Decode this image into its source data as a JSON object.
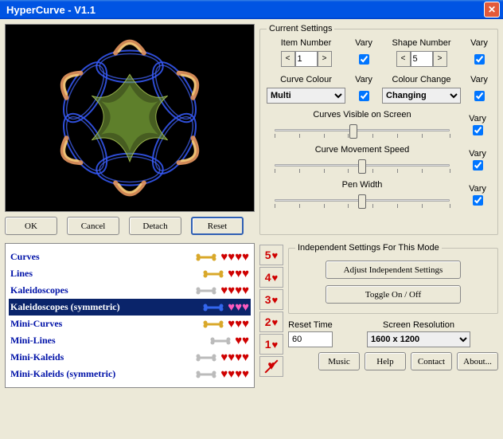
{
  "window": {
    "title": "HyperCurve - V1.1",
    "close_icon": "✕"
  },
  "buttons": {
    "ok": "OK",
    "cancel": "Cancel",
    "detach": "Detach",
    "reset": "Reset"
  },
  "settings": {
    "legend": "Current Settings",
    "item_number_label": "Item Number",
    "item_number_value": "1",
    "vary_label": "Vary",
    "shape_number_label": "Shape Number",
    "shape_number_value": "5",
    "curve_colour_label": "Curve Colour",
    "curve_colour_value": "Multi",
    "colour_change_label": "Colour Change",
    "colour_change_value": "Changing",
    "curves_visible_label": "Curves Visible on Screen",
    "movement_speed_label": "Curve Movement Speed",
    "pen_width_label": "Pen Width"
  },
  "modes": [
    {
      "name": "Curves",
      "bone": "gold",
      "hearts": 4,
      "selected": false
    },
    {
      "name": "Lines",
      "bone": "gold",
      "hearts": 3,
      "selected": false
    },
    {
      "name": "Kaleidoscopes",
      "bone": "grey",
      "hearts": 4,
      "selected": false
    },
    {
      "name": "Kaleidoscopes (symmetric)",
      "bone": "blue",
      "hearts": 3,
      "selected": true,
      "heart_color": "pink"
    },
    {
      "name": "Mini-Curves",
      "bone": "gold",
      "hearts": 3,
      "selected": false
    },
    {
      "name": "Mini-Lines",
      "bone": "grey",
      "hearts": 2,
      "selected": false
    },
    {
      "name": "Mini-Kaleids",
      "bone": "grey",
      "hearts": 4,
      "selected": false
    },
    {
      "name": "Mini-Kaleids (symmetric)",
      "bone": "grey",
      "hearts": 4,
      "selected": false
    }
  ],
  "ranks": [
    "5",
    "4",
    "3",
    "2",
    "1"
  ],
  "independent": {
    "legend": "Independent Settings For This Mode",
    "adjust": "Adjust Independent Settings",
    "toggle": "Toggle On / Off"
  },
  "reset_time": {
    "label": "Reset Time",
    "value": "60"
  },
  "resolution": {
    "label": "Screen Resolution",
    "value": "1600 x 1200"
  },
  "footer": {
    "music": "Music",
    "help": "Help",
    "contact": "Contact",
    "about": "About..."
  }
}
